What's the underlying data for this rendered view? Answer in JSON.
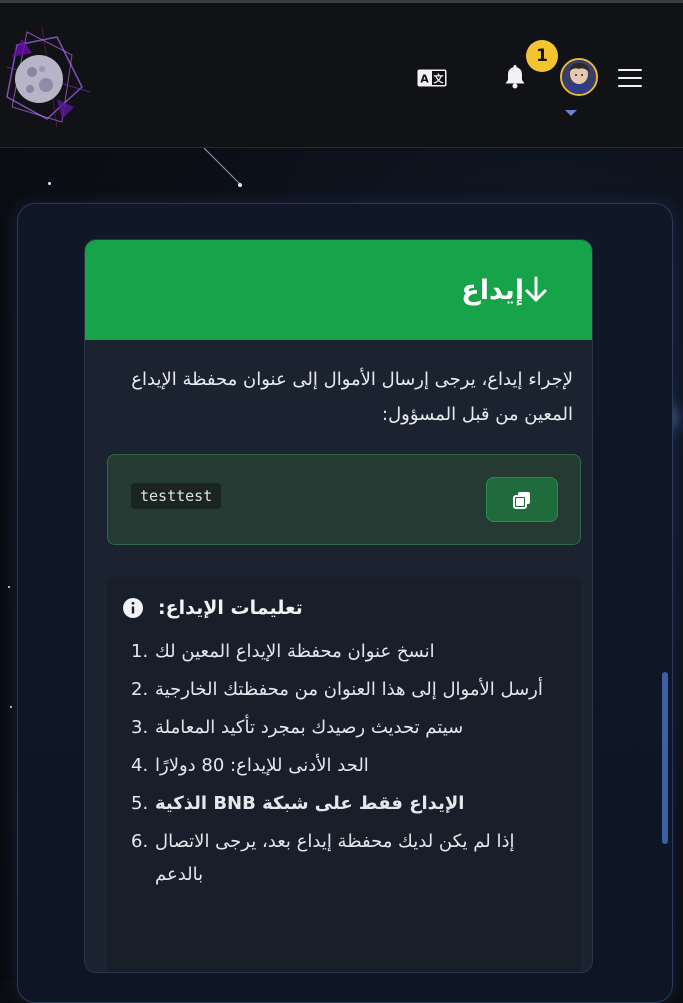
{
  "header": {
    "logo_icon": "moon-crystal-logo",
    "translate_icon": "translate-icon",
    "bell_icon": "bell-icon",
    "notification_count": "1",
    "avatar_icon": "user-avatar",
    "menu_icon": "hamburger-menu-icon"
  },
  "deposit": {
    "title": "إيداع",
    "description": "لإجراء إيداع، يرجى إرسال الأموال إلى عنوان محفظة الإيداع المعين من قبل المسؤول:",
    "address": "testtest",
    "copy_icon": "copy-icon",
    "instructions_title": "تعليمات الإيداع:",
    "steps": [
      {
        "num": "1.",
        "text": "انسخ عنوان محفظة الإيداع المعين لك"
      },
      {
        "num": "2.",
        "text": "أرسل الأموال إلى هذا العنوان من محفظتك الخارجية"
      },
      {
        "num": "3.",
        "text": "سيتم تحديث رصيدك بمجرد تأكيد المعاملة"
      },
      {
        "num": "4.",
        "text": "الحد الأدنى للإيداع: 80 دولارًا"
      },
      {
        "num": "5.",
        "text": "الإيداع فقط على شبكة BNB الذكية"
      },
      {
        "num": "6.",
        "text": "إذا لم يكن لديك محفظة إيداع بعد، يرجى الاتصال بالدعم"
      }
    ]
  },
  "colors": {
    "accent_green": "#17a34a",
    "badge_yellow": "#f4c430",
    "panel_bg": "#1c2330"
  }
}
